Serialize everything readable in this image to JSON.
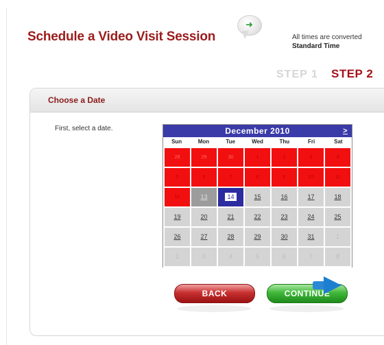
{
  "header": {
    "title": "Schedule a Video Visit Session",
    "times_note_line1": "All times are converted",
    "times_note_line2": "Standard Time"
  },
  "steps": {
    "step1": "STEP 1",
    "step2": "STEP 2"
  },
  "panel": {
    "title": "Choose a Date",
    "instruction": "First, select a date."
  },
  "calendar": {
    "month_label": "December 2010",
    "next_label": ">",
    "days_of_week": [
      "Sun",
      "Mon",
      "Tue",
      "Wed",
      "Thu",
      "Fri",
      "Sat"
    ],
    "cells": [
      {
        "label": "28",
        "state": "red-past"
      },
      {
        "label": "29",
        "state": "red-past"
      },
      {
        "label": "30",
        "state": "red-past"
      },
      {
        "label": "1",
        "state": "red"
      },
      {
        "label": "2",
        "state": "red"
      },
      {
        "label": "3",
        "state": "red"
      },
      {
        "label": "4",
        "state": "red"
      },
      {
        "label": "5",
        "state": "red"
      },
      {
        "label": "6",
        "state": "red"
      },
      {
        "label": "7",
        "state": "red"
      },
      {
        "label": "8",
        "state": "red"
      },
      {
        "label": "9",
        "state": "red"
      },
      {
        "label": "10",
        "state": "red"
      },
      {
        "label": "11",
        "state": "red"
      },
      {
        "label": "12",
        "state": "red"
      },
      {
        "label": "13",
        "state": "today"
      },
      {
        "label": "14",
        "state": "selected"
      },
      {
        "label": "15",
        "state": "available"
      },
      {
        "label": "16",
        "state": "available"
      },
      {
        "label": "17",
        "state": "available"
      },
      {
        "label": "18",
        "state": "available"
      },
      {
        "label": "19",
        "state": "available"
      },
      {
        "label": "20",
        "state": "available"
      },
      {
        "label": "21",
        "state": "available"
      },
      {
        "label": "22",
        "state": "available"
      },
      {
        "label": "23",
        "state": "available"
      },
      {
        "label": "24",
        "state": "available"
      },
      {
        "label": "25",
        "state": "available"
      },
      {
        "label": "26",
        "state": "available"
      },
      {
        "label": "27",
        "state": "available"
      },
      {
        "label": "28",
        "state": "available"
      },
      {
        "label": "29",
        "state": "available"
      },
      {
        "label": "30",
        "state": "available"
      },
      {
        "label": "31",
        "state": "available"
      },
      {
        "label": "1",
        "state": "disabled"
      },
      {
        "label": "2",
        "state": "disabled"
      },
      {
        "label": "3",
        "state": "disabled"
      },
      {
        "label": "4",
        "state": "disabled"
      },
      {
        "label": "5",
        "state": "disabled"
      },
      {
        "label": "6",
        "state": "disabled"
      },
      {
        "label": "7",
        "state": "disabled"
      },
      {
        "label": "8",
        "state": "disabled"
      }
    ]
  },
  "buttons": {
    "back": "BACK",
    "continue": "CONTINUE"
  },
  "icons": {
    "bubble": "chat-bubble-arrow-icon",
    "continue_arrow": "arrow-right-icon"
  },
  "colors": {
    "title": "#9a1c1c",
    "step_active": "#a5121a",
    "step_inactive": "#d6d6d6",
    "calendar_header": "#3a3aa8",
    "unavailable": "#f20f0f",
    "available": "#d4d4d4",
    "back_button": "#c83030",
    "continue_button": "#40b83a"
  }
}
